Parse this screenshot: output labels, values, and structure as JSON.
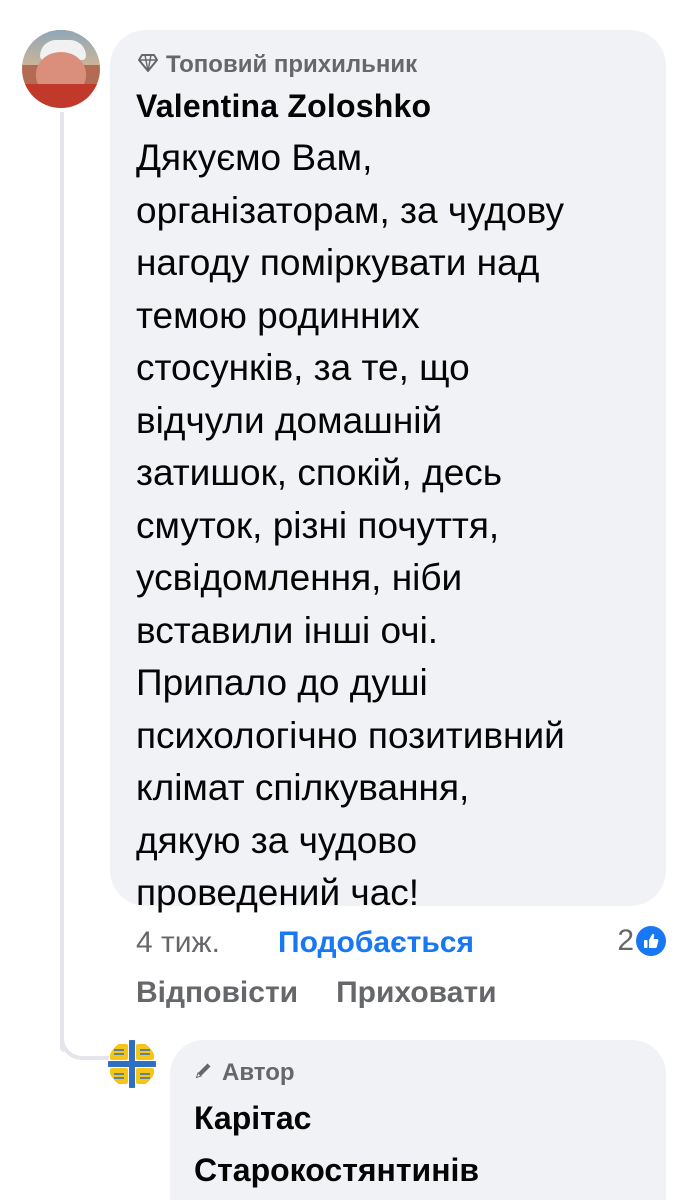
{
  "comment": {
    "badge_label": "Топовий прихильник",
    "author": "Valentina  Zoloshko",
    "text": "Дякуємо Вам,\nорганізаторам, за чудову\nнагоду поміркувати над\nтемою родинних\nстосунків, за те, що\nвідчули домашній\nзатишок, спокій, десь\nсмуток, різні почуття,\nусвідомлення, ніби\nвставили інші очі.\nПрипало до душі\nпсихологічно позитивний\nклімат спілкування,\nдякую за чудово\nпроведений час!",
    "time": "4 тиж.",
    "like_label": "Подобається",
    "reaction_count": "2",
    "reply_label": "Відповісти",
    "hide_label": "Приховати"
  },
  "reply": {
    "badge_label": "Автор",
    "author": "Карітас Старокостянтинів"
  },
  "colors": {
    "accent": "#1877f2",
    "bubble": "#f0f2f5",
    "secondary_text": "#65676b"
  },
  "icons": {
    "badge": "diamond-icon",
    "author_badge": "pencil-icon",
    "reaction": "thumbs-up-icon"
  }
}
